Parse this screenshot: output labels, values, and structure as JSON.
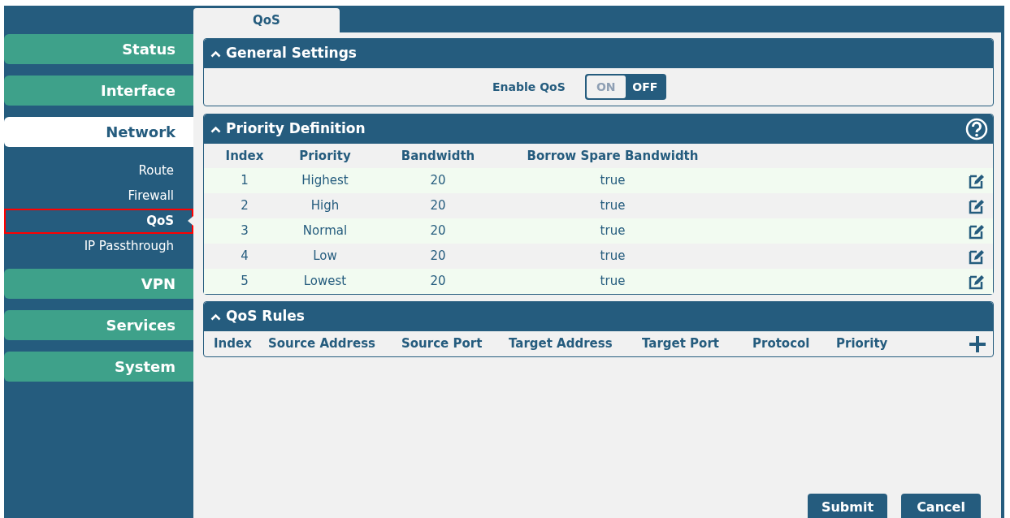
{
  "nav": [
    {
      "label": "Status",
      "selected": false
    },
    {
      "label": "Interface",
      "selected": false
    },
    {
      "label": "Network",
      "selected": true,
      "children": [
        {
          "label": "Route",
          "selected": false
        },
        {
          "label": "Firewall",
          "selected": false
        },
        {
          "label": "QoS",
          "selected": true
        },
        {
          "label": "IP Passthrough",
          "selected": false
        }
      ]
    },
    {
      "label": "VPN",
      "selected": false
    },
    {
      "label": "Services",
      "selected": false
    },
    {
      "label": "System",
      "selected": false
    }
  ],
  "tabs": [
    {
      "label": "QoS",
      "selected": true
    }
  ],
  "general_settings": {
    "title": "General Settings",
    "enable_qos": {
      "label": "Enable QoS",
      "on": false,
      "on_label": "ON",
      "off_label": "OFF"
    }
  },
  "priority_definition": {
    "title": "Priority Definition",
    "columns": [
      "Index",
      "Priority",
      "Bandwidth",
      "Borrow Spare Bandwidth"
    ],
    "rows": [
      [
        "1",
        "Highest",
        "20",
        "true"
      ],
      [
        "2",
        "High",
        "20",
        "true"
      ],
      [
        "3",
        "Normal",
        "20",
        "true"
      ],
      [
        "4",
        "Low",
        "20",
        "true"
      ],
      [
        "5",
        "Lowest",
        "20",
        "true"
      ]
    ]
  },
  "qos_rules": {
    "title": "QoS Rules",
    "columns": [
      "Index",
      "Source Address",
      "Source Port",
      "Target Address",
      "Target Port",
      "Protocol",
      "Priority"
    ]
  },
  "buttons": [
    "Submit",
    "Cancel"
  ]
}
